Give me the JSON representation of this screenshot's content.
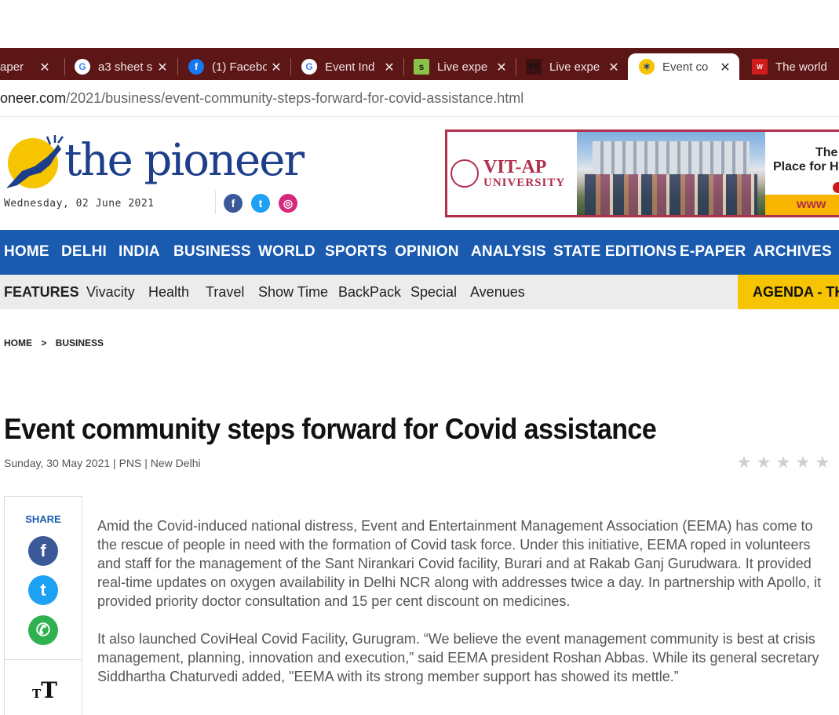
{
  "browser": {
    "tabs": [
      {
        "title": "Paper Size",
        "icon": "paper-icon",
        "active": false
      },
      {
        "title": "a3 sheet s",
        "icon": "google-icon",
        "active": false
      },
      {
        "title": "(1) Facebo",
        "icon": "facebook-icon",
        "active": false
      },
      {
        "title": "Event Ind",
        "icon": "google-icon",
        "active": false
      },
      {
        "title": "Live expe",
        "icon": "s-logo-icon",
        "active": false
      },
      {
        "title": "Live expe",
        "icon": "vs-logo-icon",
        "active": false
      },
      {
        "title": "Event co",
        "icon": "pioneer-icon",
        "active": true
      },
      {
        "title": "The world",
        "icon": "the-week-icon",
        "active": false
      }
    ],
    "close_glyph": "✕",
    "url_host": "pioneer.com",
    "url_path": "/2021/business/event-community-steps-forward-for-covid-assistance.html"
  },
  "site": {
    "logo_text": "the pioneer",
    "date": "Wednesday, 02 June 2021",
    "social": [
      {
        "name": "facebook-icon",
        "glyph": "f",
        "color": "#3b5998"
      },
      {
        "name": "twitter-icon",
        "glyph": "t",
        "color": "#1da1f2"
      },
      {
        "name": "instagram-icon",
        "glyph": "◎",
        "color": "#d6297b"
      }
    ]
  },
  "ad": {
    "brand_line1": "VIT-AP",
    "brand_line2": "UNIVERSITY",
    "tagline1": "The",
    "tagline2": "Place for H",
    "url_fragment": "www"
  },
  "nav": {
    "main": [
      "HOME",
      "DELHI",
      "INDIA",
      "BUSINESS",
      "WORLD",
      "SPORTS",
      "OPINION",
      "ANALYSIS",
      "STATE EDITIONS",
      "E-PAPER",
      "ARCHIVES"
    ],
    "sub": [
      "FEATURES",
      "Vivacity",
      "Health",
      "Travel",
      "Show Time",
      "BackPack",
      "Special",
      "Avenues"
    ],
    "agenda": "AGENDA - THE"
  },
  "breadcrumb": {
    "items": [
      "HOME",
      ">",
      "BUSINESS"
    ]
  },
  "article": {
    "headline": "Event community steps forward for Covid assistance",
    "byline": "Sunday, 30 May 2021 | PNS | New Delhi",
    "rating": 0,
    "rating_max": 5,
    "paragraphs": [
      "Amid the Covid-induced national distress, Event and Entertainment Management Association (EEMA) has come to the rescue of people in need with the formation of Covid task force. Under this initiative, EEMA roped in volunteers and staff for the management of the Sant Nirankari Covid facility, Burari and at Rakab Ganj Gurudwara. It provided real-time updates on oxygen availability in Delhi NCR along with addresses twice a day. In partnership with Apollo, it provided priority doctor consultation and 15 per cent discount on medicines.",
      "It also launched CoviHeal Covid Facility, Gurugram. “We believe the event management community is best at crisis management, planning, innovation and execution,” said EEMA president Roshan Abbas. While its general secretary Siddhartha Chaturvedi added, \"EEMA with its strong member support has showed its mettle.”"
    ]
  },
  "share": {
    "label": "SHARE",
    "buttons": [
      {
        "name": "share-facebook-icon",
        "glyph": "f",
        "color": "#3b5998"
      },
      {
        "name": "share-twitter-icon",
        "glyph": "t",
        "color": "#1da1f2"
      },
      {
        "name": "share-whatsapp-icon",
        "glyph": "✆",
        "color": "#2fb150"
      }
    ],
    "text_size_small": "T",
    "text_size_big": "T"
  }
}
